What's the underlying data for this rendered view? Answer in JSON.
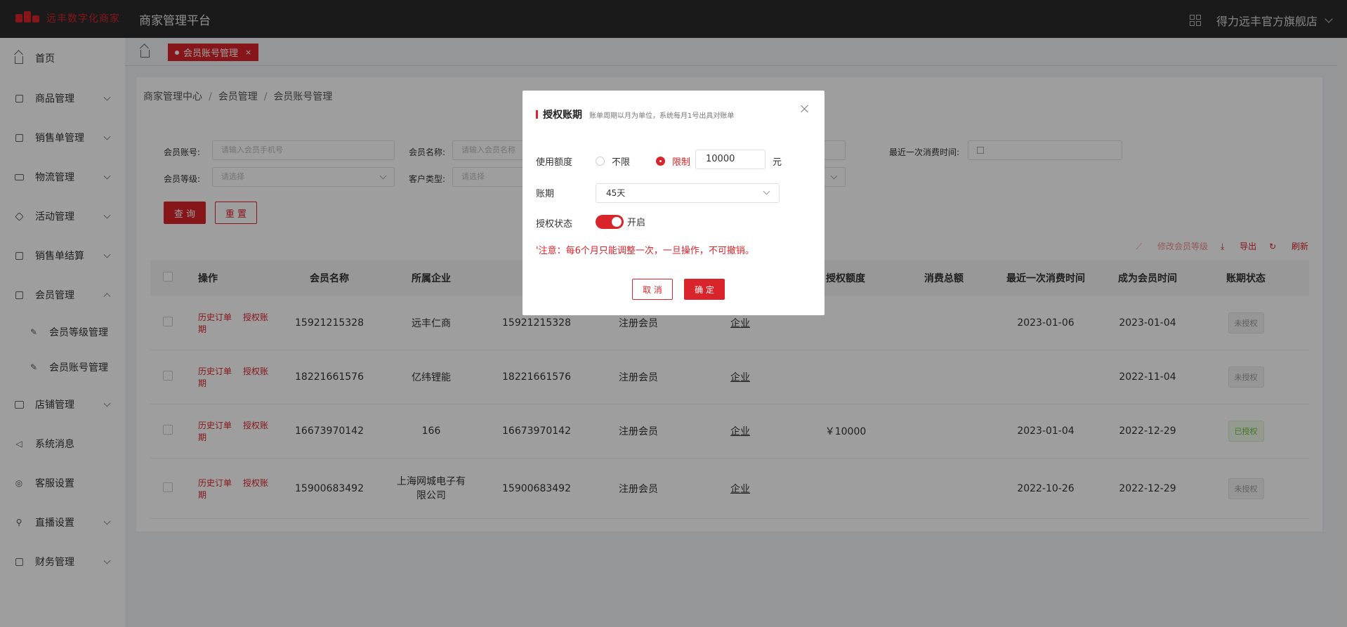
{
  "header": {
    "logo_text": "远丰数字化商家",
    "platform_title": "商家管理平台",
    "store_name": "得力远丰官方旗舰店",
    "grid_icon": "grid-icon"
  },
  "sidebar": {
    "items": [
      {
        "label": "首页",
        "icon": "home-icon"
      },
      {
        "label": "商品管理",
        "icon": "box-icon"
      },
      {
        "label": "销售单管理",
        "icon": "clipboard-icon"
      },
      {
        "label": "物流管理",
        "icon": "truck-icon"
      },
      {
        "label": "活动管理",
        "icon": "tag-icon"
      },
      {
        "label": "销售单结算",
        "icon": "ledger-icon"
      },
      {
        "label": "会员管理",
        "icon": "member-icon"
      },
      {
        "label": "店铺管理",
        "icon": "store-icon"
      },
      {
        "label": "系统消息",
        "icon": "speaker-icon"
      },
      {
        "label": "客服设置",
        "icon": "service-icon"
      },
      {
        "label": "直播设置",
        "icon": "live-icon"
      },
      {
        "label": "财务管理",
        "icon": "finance-icon"
      }
    ],
    "subitems": [
      {
        "label": "会员等级管理"
      },
      {
        "label": "会员账号管理"
      }
    ]
  },
  "tabs": {
    "active_label": "会员账号管理",
    "close_glyph": "×"
  },
  "breadcrumb": {
    "items": [
      "商家管理中心",
      "会员管理",
      "会员账号管理"
    ],
    "separator": "/"
  },
  "filters": {
    "account_label": "会员账号:",
    "account_placeholder": "请输入会员手机号",
    "name_label": "会员名称:",
    "name_placeholder": "请输入会员名称",
    "last_time_label": "最近一次消费时间:",
    "level_label": "会员等级:",
    "level_placeholder": "请选择",
    "type_label": "客户类型:",
    "type_placeholder": "请选择",
    "search_button": "查 询",
    "reset_button": "重 置"
  },
  "toolbar": {
    "edit_level": "修改会员等级",
    "export": "导出",
    "refresh": "刷新"
  },
  "table": {
    "headers": {
      "op": "操作",
      "name": "会员名称",
      "company": "所属企业",
      "credit": "授权额度",
      "total": "消费总额",
      "last": "最近一次消费时间",
      "since": "成为会员时间",
      "status": "账期状态"
    },
    "rows": [
      {
        "op1": "历史订单",
        "op2": "授权账期",
        "name": "15921215328",
        "company": "远丰仁商",
        "account": "15921215328",
        "type": "注册会员",
        "kind": "企业",
        "credit": "",
        "total": "",
        "last": "2023-01-06",
        "since": "2023-01-04",
        "status": "未授权"
      },
      {
        "op1": "历史订单",
        "op2": "授权账期",
        "name": "18221661576",
        "company": "亿纬锂能",
        "account": "18221661576",
        "type": "注册会员",
        "kind": "企业",
        "credit": "",
        "total": "",
        "last": "",
        "since": "2022-11-04",
        "status": "未授权"
      },
      {
        "op1": "历史订单",
        "op2": "授权账期",
        "name": "16673970142",
        "company": "166",
        "account": "16673970142",
        "type": "注册会员",
        "kind": "企业",
        "credit": "￥10000",
        "total": "",
        "last": "2023-01-04",
        "since": "2022-12-29",
        "status": "已授权"
      },
      {
        "op1": "历史订单",
        "op2": "授权账期",
        "name": "15900683492",
        "company": "上海网城电子有限公司",
        "account": "15900683492",
        "type": "注册会员",
        "kind": "企业",
        "credit": "",
        "total": "",
        "last": "2022-10-26",
        "since": "2022-12-29",
        "status": "未授权"
      }
    ]
  },
  "modal": {
    "title": "授权账期",
    "subtitle": "账单周期以月为单位，系统每月1号出具对账单",
    "quota_label": "使用额度",
    "option_unlimited": "不限",
    "option_limited": "限制",
    "quota_value": "10000",
    "unit": "元",
    "period_label": "账期",
    "period_value": "45天",
    "status_label": "授权状态",
    "status_value": "开启",
    "warning": "'注意：每6个月只能调整一次，一旦操作，不可撤销。",
    "cancel": "取 消",
    "confirm": "确 定"
  },
  "colors": {
    "brand": "#d9242b",
    "topbar": "#2b2b2b",
    "success": "#67c23a"
  }
}
